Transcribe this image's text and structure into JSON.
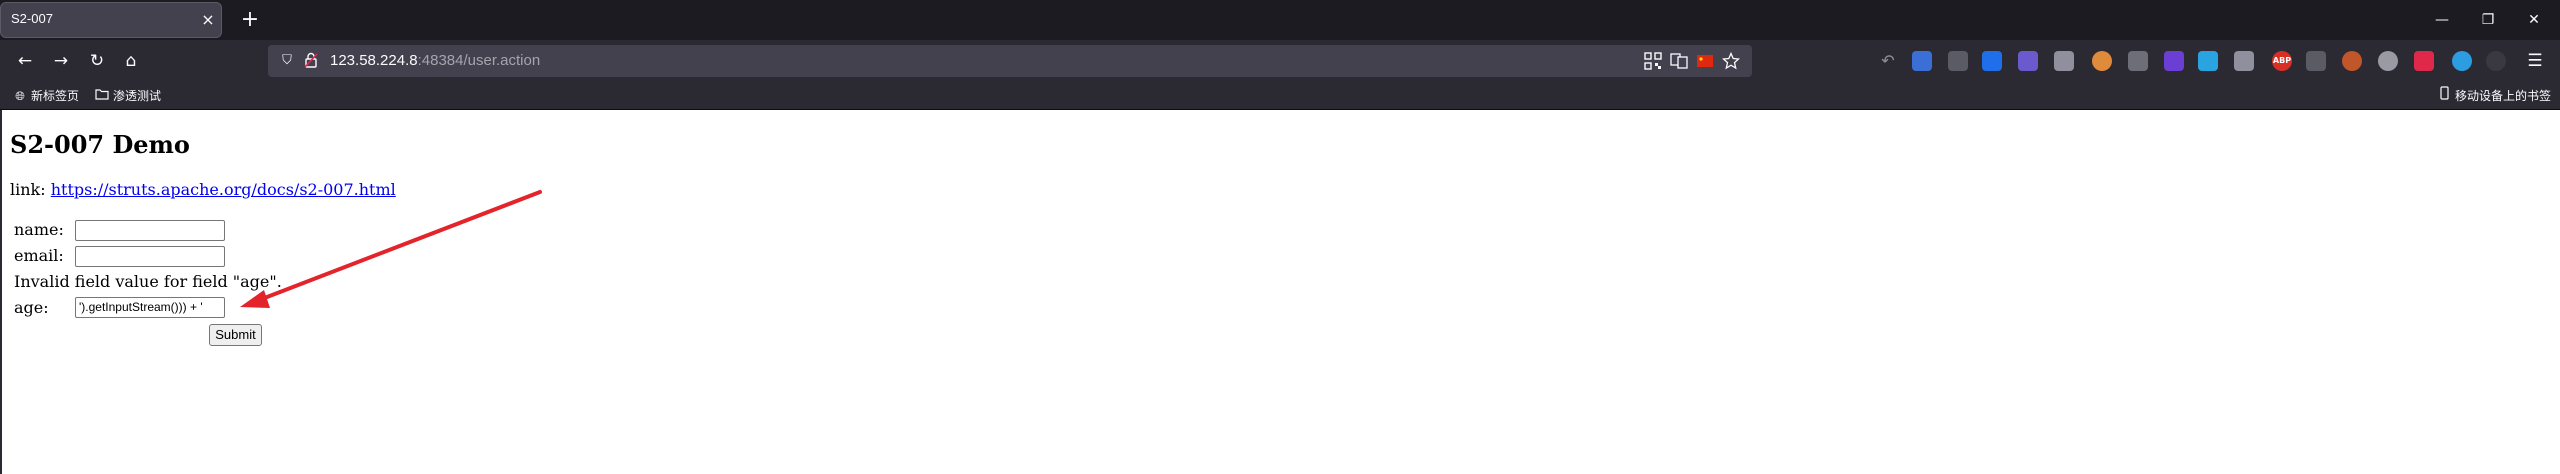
{
  "browser": {
    "tab_title": "S2-007",
    "tab_close": "×",
    "new_tab": "+",
    "window": {
      "minimize": "—",
      "restore": "❐",
      "close": "✕"
    },
    "url_host": "123.58.224.8",
    "url_rest": ":48384/user.action",
    "bookmarks": [
      "新标签页",
      "渗透测试"
    ],
    "mobile_bookmarks": "移动设备上的书签",
    "extension_abp": "ABP"
  },
  "page": {
    "title": "S2-007 Demo",
    "link_prefix": "link: ",
    "link_url": "https://struts.apache.org/docs/s2-007.html",
    "form": {
      "name_label": "name:",
      "name_value": "",
      "email_label": "email:",
      "email_value": "",
      "error": "Invalid field value for field \"age\".",
      "age_label": "age:",
      "age_value": "').getInputStream())) + '",
      "submit": "Submit"
    }
  }
}
